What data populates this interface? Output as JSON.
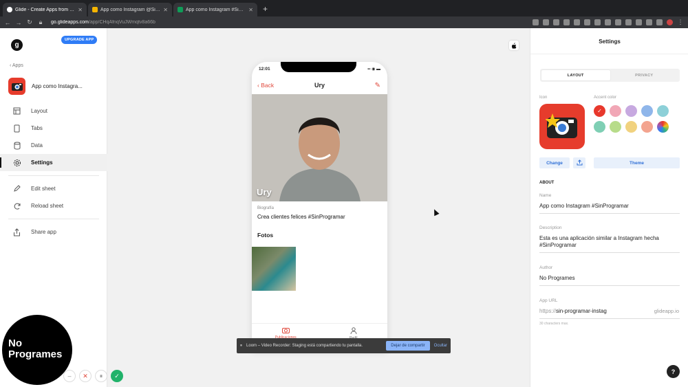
{
  "browser": {
    "tabs": [
      {
        "title": "Glide - Create Apps from Goo...",
        "color": "#222222"
      },
      {
        "title": "App como Instagram @SinPro...",
        "color": "#1a73e8"
      },
      {
        "title": "App como Instagram #SinProg...",
        "color": "#0f9d58"
      }
    ],
    "url_host": "go.glideapps.com",
    "url_path": "/app/CHqAfnqVuJWmqtv8a66b"
  },
  "sidebar": {
    "logo": "g",
    "upgrade_label": "UPGRADE APP",
    "back_label": "‹ Apps",
    "app_name": "App como Instagra...",
    "items": [
      {
        "label": "Layout",
        "icon": "layout-icon"
      },
      {
        "label": "Tabs",
        "icon": "tabs-icon"
      },
      {
        "label": "Data",
        "icon": "data-icon"
      },
      {
        "label": "Settings",
        "icon": "gear-icon"
      },
      {
        "label": "Edit sheet",
        "icon": "pencil-icon"
      },
      {
        "label": "Reload sheet",
        "icon": "reload-icon"
      },
      {
        "label": "Share app",
        "icon": "share-icon"
      }
    ],
    "active_item": "Settings"
  },
  "overlay": {
    "watermark_line1": "No",
    "watermark_line2": "Programes"
  },
  "phone": {
    "time": "12:01",
    "status_icons": "▪▪ ◉ ▬",
    "back_label": "Back",
    "title": "Ury",
    "hero_name": "Ury",
    "bio_label": "Biografía",
    "bio_text": "Crea clientes felices #SinProgramar",
    "photos_label": "Fotos",
    "tab_left": "Publicaciones",
    "tab_right": "Perfil"
  },
  "toast": {
    "icon": "⏸",
    "message": "Loom – Video Recorder: Staging está compartiendo tu pantalla.",
    "stop_label": "Dejar de compartir",
    "hide_label": "Ocultar"
  },
  "settings": {
    "title": "Settings",
    "seg_layout": "LAYOUT",
    "seg_privacy": "PRIVACY",
    "icon_label": "Icon",
    "accent_label": "Accent color",
    "change_label": "Change",
    "theme_label": "Theme",
    "about_label": "ABOUT",
    "name_label": "Name",
    "name_value": "App como Instagram #SinProgramar",
    "description_label": "Description",
    "description_value": "Esta es una aplicación similar a Instagram hecha #SinProgramar",
    "author_label": "Author",
    "author_value": "No Programes",
    "url_label": "App URL",
    "url_prefix": "https://",
    "url_value": "sin-programar-instag",
    "url_suffix": "glideapp.io",
    "url_hint": "30 characters max.",
    "help_label": "?",
    "accent_colors": [
      "#e8382c",
      "#f1a7b6",
      "#c7a9e0",
      "#8fb6ea",
      "#8dd0d8",
      "#7fcfb4",
      "#b7dc8a",
      "#f1d27f",
      "#f3a48f"
    ]
  }
}
